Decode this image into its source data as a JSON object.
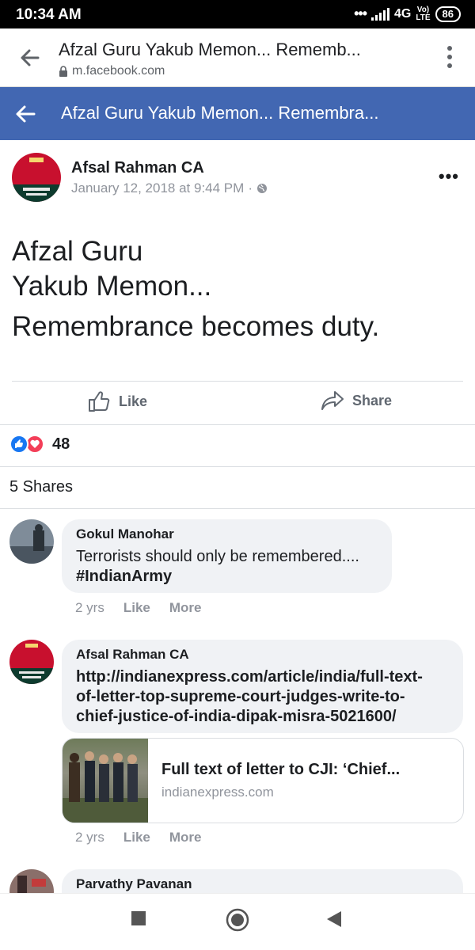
{
  "status": {
    "time": "10:34 AM",
    "network": "4G",
    "carrier": "Vo)",
    "lte": "LTE",
    "battery": "86"
  },
  "browser": {
    "title": "Afzal Guru Yakub Memon... Rememb...",
    "url": "m.facebook.com"
  },
  "fb_header": {
    "title": "Afzal Guru Yakub Memon... Remembra..."
  },
  "post": {
    "author": "Afsal Rahman CA",
    "timestamp": "January 12, 2018 at 9:44 PM",
    "separator": "·",
    "text_line1": "Afzal Guru",
    "text_line2": "Yakub Memon...",
    "text_line3": "Remembrance becomes duty."
  },
  "actions": {
    "like": "Like",
    "share": "Share"
  },
  "reactions": {
    "count": "48"
  },
  "shares": "5 Shares",
  "comments": [
    {
      "author": "Gokul Manohar",
      "text": "Terrorists should only be remembered....",
      "tag": "#IndianArmy",
      "time": "2 yrs",
      "like": "Like",
      "more": "More"
    },
    {
      "author": "Afsal Rahman CA",
      "link_line1": "http://indianexpress.com/article/india/full-text-",
      "link_line2": "of-letter-top-supreme-court-judges-write-to-",
      "link_line3": "chief-justice-of-india-dipak-misra-5021600/",
      "card_title": "Full text of letter to CJI: ‘Chief...",
      "card_domain": "indianexpress.com",
      "time": "2 yrs",
      "like": "Like",
      "more": "More"
    },
    {
      "author": "Parvathy Pavanan"
    }
  ],
  "colors": {
    "fb_blue": "#4267b2",
    "like_blue": "#1877f2",
    "love_red": "#f33e58",
    "bubble": "#f0f2f5"
  }
}
